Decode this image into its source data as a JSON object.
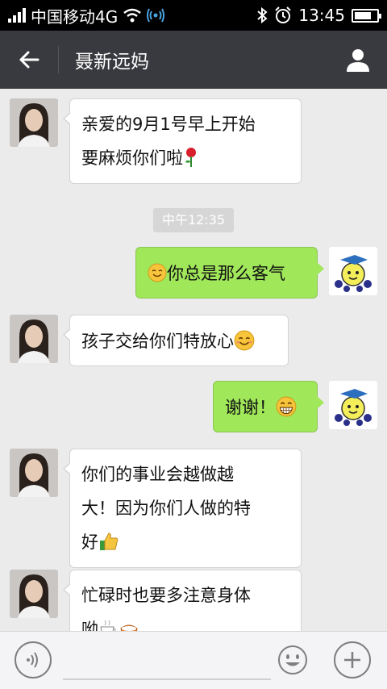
{
  "status_bar": {
    "carrier": "中国移动4G",
    "time": "13:45",
    "battery_level": 0.75
  },
  "header": {
    "title": "聂新远妈"
  },
  "messages": [
    {
      "side": "left",
      "lines": [
        "亲爱的9月1号早上开始",
        "要麻烦你们啦"
      ],
      "emoji": "rose"
    },
    {
      "side": "right",
      "lead_emoji": "smile",
      "text": "你总是那么客气"
    },
    {
      "side": "left",
      "text": "孩子交给你们特放心",
      "emoji": "blush"
    },
    {
      "side": "right",
      "text": "谢谢！",
      "emoji": "grin"
    },
    {
      "side": "left",
      "lines": [
        "你们的事业会越做越",
        "大！因为你们人做的特",
        "好"
      ],
      "emoji": "thumbs-up"
    },
    {
      "side": "left",
      "lines": [
        "忙碌时也要多注意身体",
        "呦"
      ],
      "emoji": "coffee"
    }
  ],
  "timestamp": "中午12:35",
  "colors": {
    "title_bar": "#393a3f",
    "sent_bubble": "#a0e75a",
    "received_bubble": "#ffffff",
    "chat_background": "#ebebeb"
  }
}
